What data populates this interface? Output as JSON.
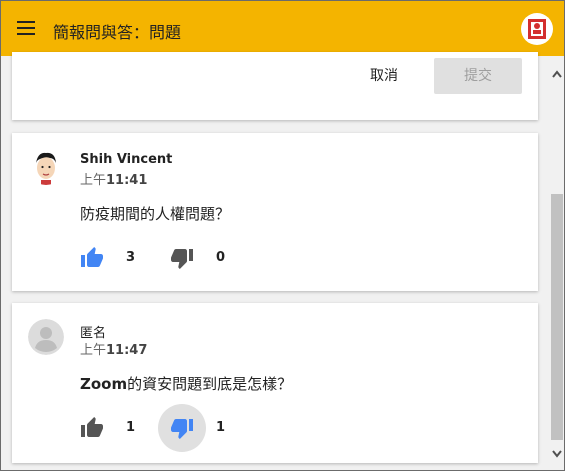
{
  "header": {
    "title": "簡報問與答：問題",
    "menu_icon": "hamburger-menu-icon",
    "logo_icon": "app-logo-icon",
    "background_color": "#f4b400"
  },
  "compose": {
    "cancel_label": "取消",
    "submit_label": "提交"
  },
  "questions": [
    {
      "author": "Shih Vincent",
      "time_prefix": "上午",
      "time": "11:41",
      "text": "防疫期間的人權問題？",
      "upvotes": "3",
      "downvotes": "0",
      "avatar_icon": "user-photo-avatar",
      "upvote_color": "#4285f4",
      "downvote_color": "#555555"
    },
    {
      "author": "匿名",
      "time_prefix": "上午",
      "time": "11:47",
      "text_bold": "Zoom",
      "text_rest": "的資安問題到底是怎樣？",
      "upvotes": "1",
      "downvotes": "1",
      "avatar_icon": "anonymous-avatar",
      "upvote_color": "#555555",
      "downvote_color": "#4285f4",
      "downvote_active": true
    }
  ]
}
